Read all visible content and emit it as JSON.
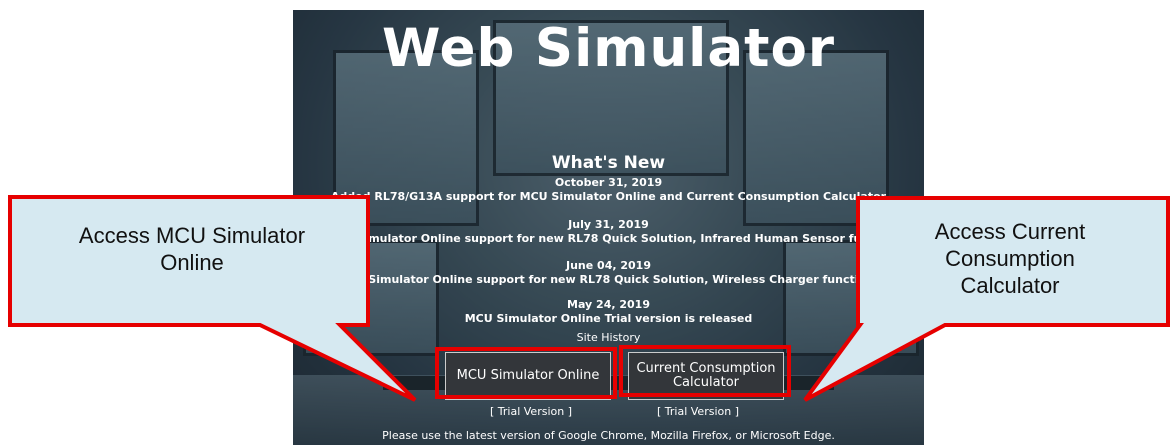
{
  "page": {
    "title": "Web Simulator",
    "whats_new_heading": "What's New"
  },
  "news": [
    {
      "date": "October 31, 2019",
      "text": "Added RL78/G13A support for MCU Simulator Online and Current Consumption Calculator"
    },
    {
      "date": "July 31, 2019",
      "text": "MCU Simulator Online support for new RL78 Quick Solution, Infrared Human Sensor functio"
    },
    {
      "date": "June 04, 2019",
      "text": "MCU Simulator Online support for new RL78 Quick Solution, Wireless Charger functions"
    },
    {
      "date": "May 24, 2019",
      "text": "MCU Simulator Online Trial version is released"
    }
  ],
  "site_history_label": "Site History",
  "buttons": {
    "mcu_label": "MCU Simulator Online",
    "ccc_label_line1": "Current Consumption",
    "ccc_label_line2": "Calculator"
  },
  "trial_labels": {
    "mcu": "[ Trial Version ]",
    "ccc": "[ Trial Version ]"
  },
  "footer_note": "Please use the latest version of Google Chrome, Mozilla Firefox, or Microsoft Edge.",
  "callouts": {
    "left_line1": "Access MCU Simulator",
    "left_line2": "Online",
    "right_line1": "Access Current",
    "right_line2": "Consumption",
    "right_line3": "Calculator"
  },
  "colors": {
    "callout_fill": "#d6e9f1",
    "highlight_red": "#e60000"
  }
}
